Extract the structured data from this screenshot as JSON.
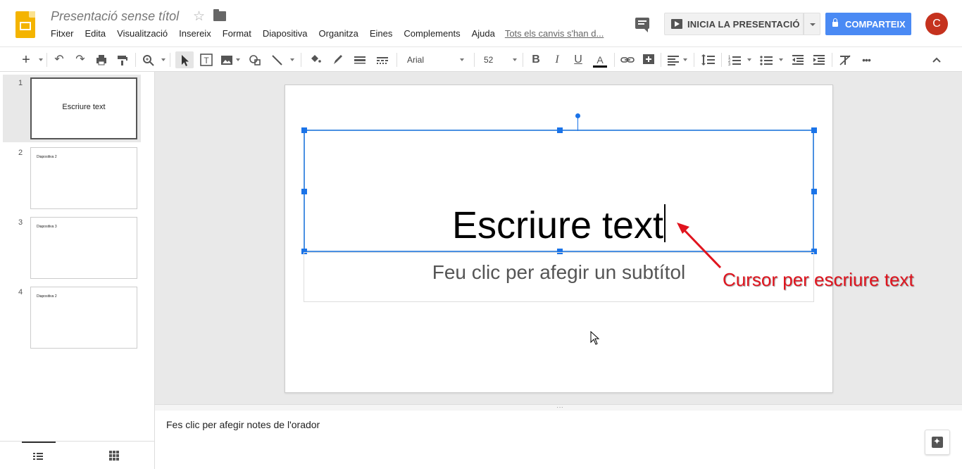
{
  "app": {
    "title": "Presentació sense títol"
  },
  "menu": {
    "items": [
      "Fitxer",
      "Edita",
      "Visualització",
      "Insereix",
      "Format",
      "Diapositiva",
      "Organitza",
      "Eines",
      "Complements",
      "Ajuda"
    ],
    "last_edit": "Tots els canvis s'han d..."
  },
  "header_actions": {
    "present_label": "INICIA LA PRESENTACIÓ",
    "share_label": "COMPARTEIX",
    "avatar_letter": "C",
    "share_color": "#4a8af4",
    "avatar_color": "#c5321e"
  },
  "toolbar": {
    "font_name": "Arial",
    "font_size": "52"
  },
  "filmstrip": {
    "slides": [
      {
        "number": "1",
        "text": "Escriure text"
      },
      {
        "number": "2",
        "text": "Diapositiva 2"
      },
      {
        "number": "3",
        "text": "Diapositiva 3"
      },
      {
        "number": "4",
        "text": "Diapositiva 2"
      }
    ]
  },
  "slide": {
    "title_text": "Escriure text",
    "subtitle_placeholder": "Feu clic per afegir un subtítol",
    "selection_color": "#4a90e2"
  },
  "annotation": {
    "text": "Cursor per escriure text",
    "color": "#e0141e"
  },
  "notes": {
    "placeholder": "Fes clic per afegir notes de l'orador"
  }
}
